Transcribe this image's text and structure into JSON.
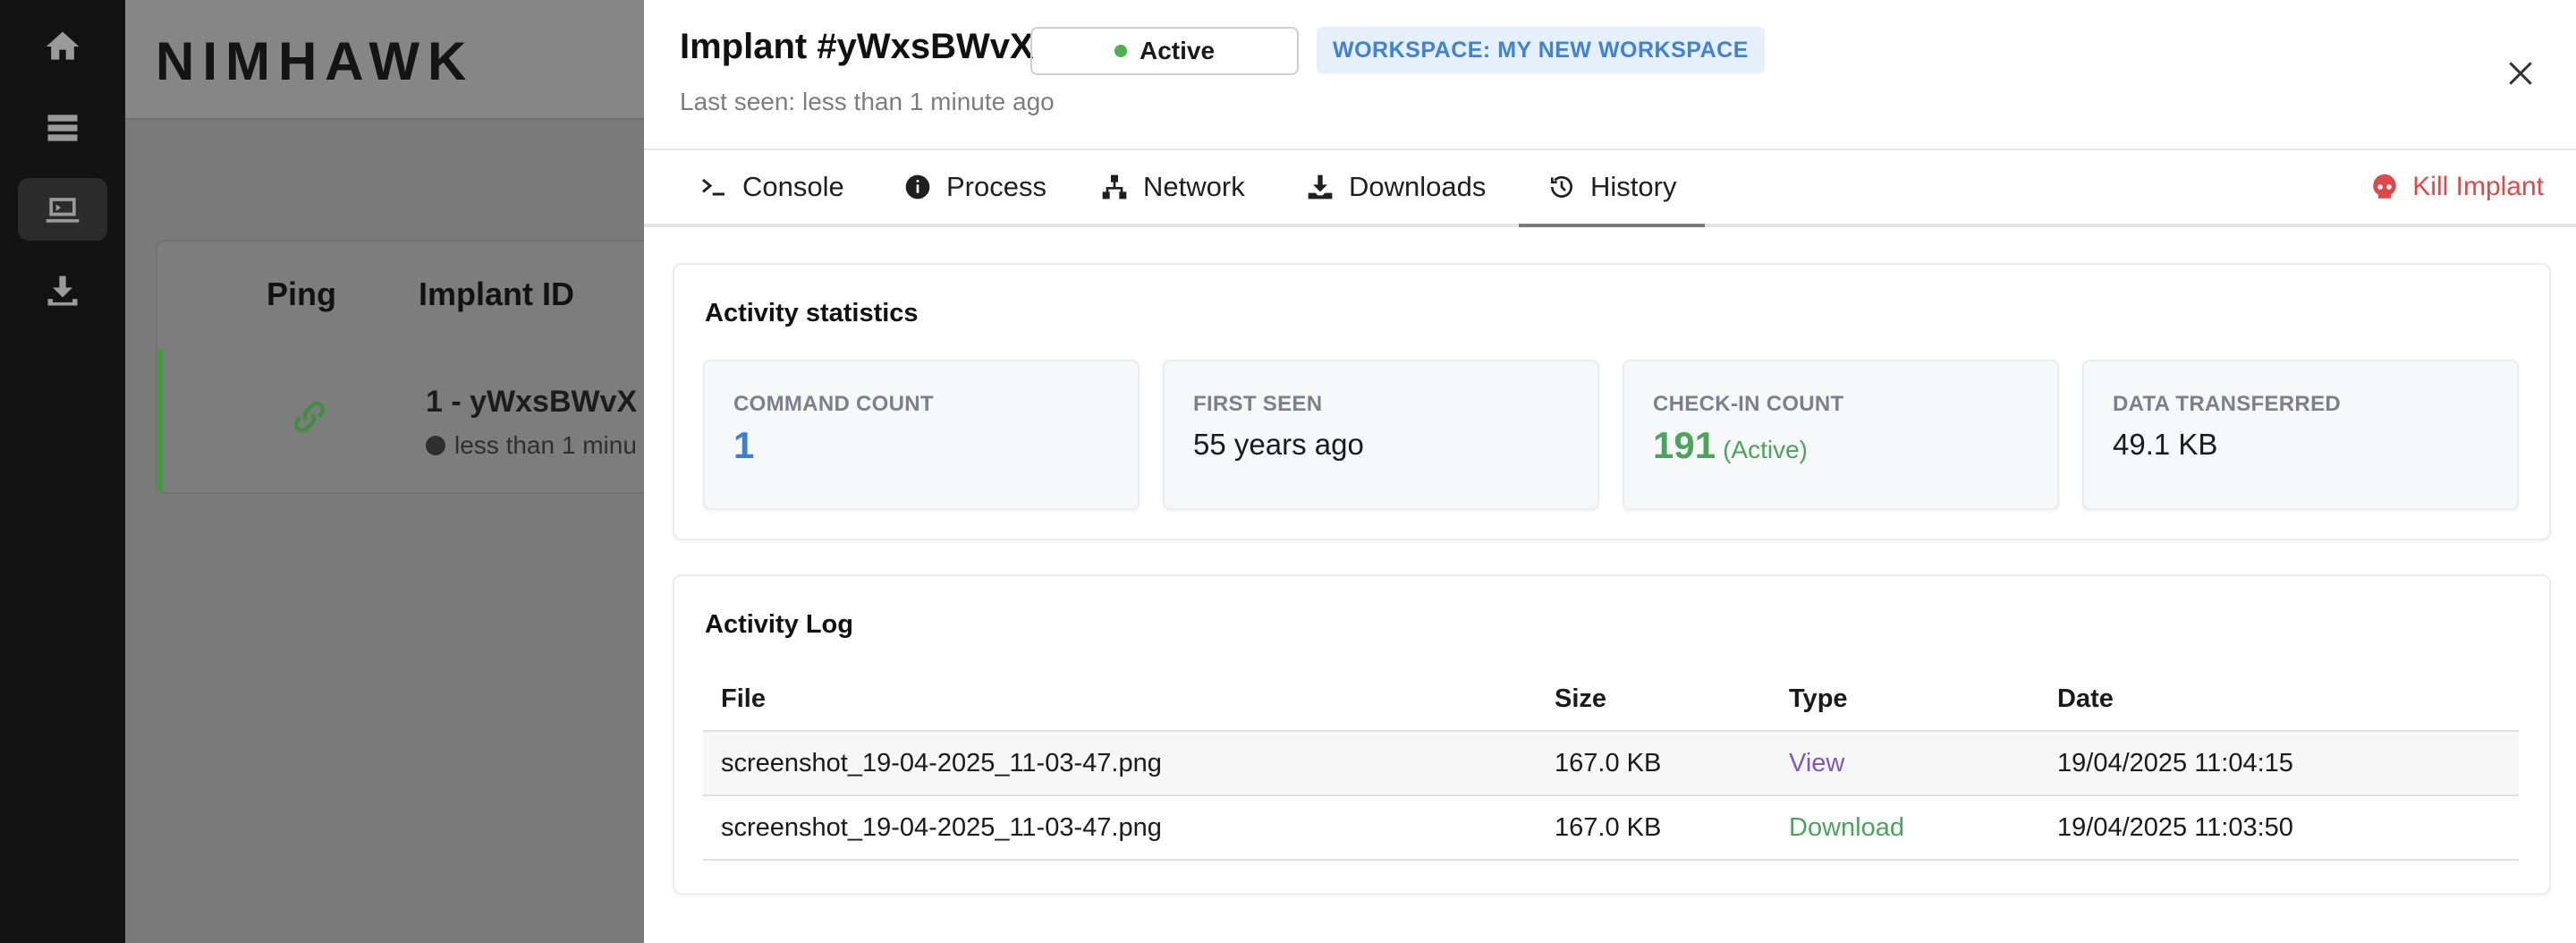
{
  "sidebar": {
    "items": [
      {
        "icon": "home-icon"
      },
      {
        "icon": "server-icon"
      },
      {
        "icon": "implant-icon",
        "active": true
      },
      {
        "icon": "download-icon"
      }
    ]
  },
  "background": {
    "logo": "NIMHAWK",
    "table_headers": {
      "ping": "Ping",
      "implant_id": "Implant ID"
    },
    "row": {
      "id": "1 - yWxsBWvX",
      "time": "less than 1 minu"
    }
  },
  "panel": {
    "title": "Implant #yWxsBWvX",
    "status": "Active",
    "status_color": "#4caf50",
    "workspace_badge": "WORKSPACE: MY NEW WORKSPACE",
    "last_seen": "Last seen: less than 1 minute ago",
    "tabs": [
      {
        "label": "Console",
        "icon": "terminal-icon"
      },
      {
        "label": "Process",
        "icon": "info-icon"
      },
      {
        "label": "Network",
        "icon": "network-icon"
      },
      {
        "label": "Downloads",
        "icon": "download-icon"
      },
      {
        "label": "History",
        "icon": "history-icon",
        "active": true
      }
    ],
    "kill_label": "Kill Implant",
    "kill_color": "#e04848"
  },
  "activity_statistics": {
    "title": "Activity statistics",
    "cards": [
      {
        "label": "COMMAND COUNT",
        "value": "1"
      },
      {
        "label": "FIRST SEEN",
        "value": "55 years ago"
      },
      {
        "label": "CHECK-IN COUNT",
        "value": "191",
        "sub": "(Active)"
      },
      {
        "label": "DATA TRANSFERRED",
        "value": "49.1 KB"
      }
    ]
  },
  "activity_log": {
    "title": "Activity Log",
    "columns": [
      "File",
      "Size",
      "Type",
      "Date"
    ],
    "rows": [
      {
        "file": "screenshot_19-04-2025_11-03-47.png",
        "size": "167.0 KB",
        "type": "View",
        "date": "19/04/2025 11:04:15"
      },
      {
        "file": "screenshot_19-04-2025_11-03-47.png",
        "size": "167.0 KB",
        "type": "Download",
        "date": "19/04/2025 11:03:50"
      }
    ]
  }
}
